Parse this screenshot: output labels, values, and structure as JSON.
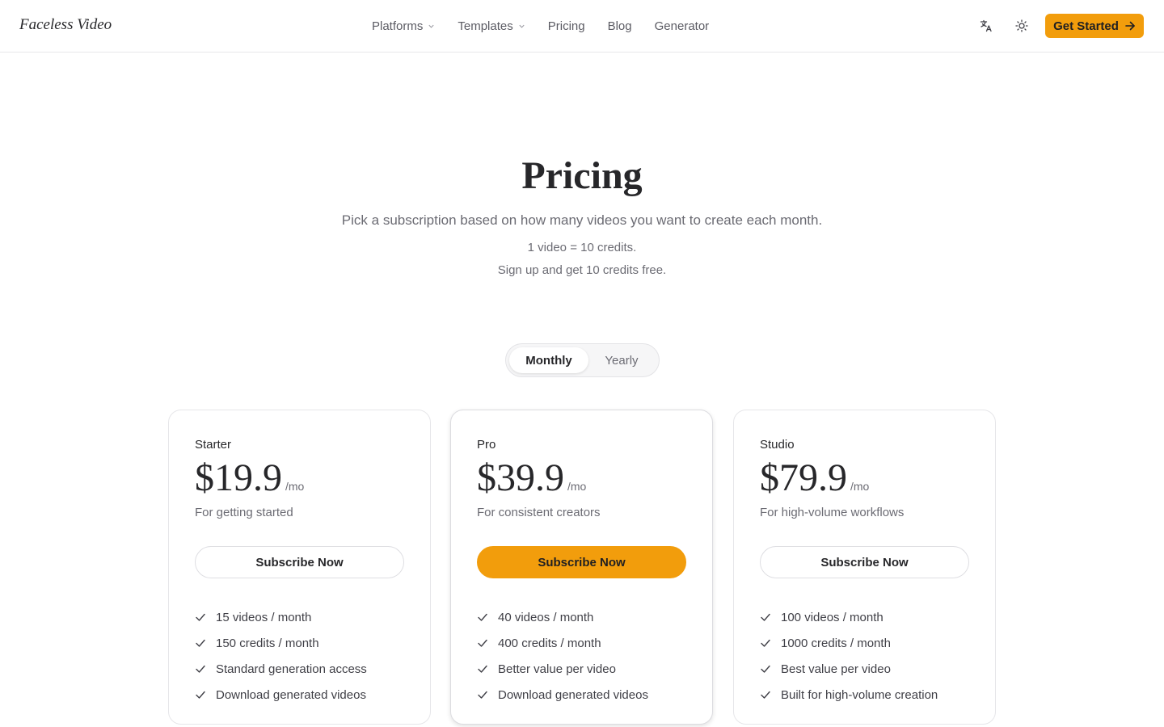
{
  "header": {
    "logo": "Faceless Video",
    "nav": [
      {
        "label": "Platforms",
        "has_dropdown": true
      },
      {
        "label": "Templates",
        "has_dropdown": true
      },
      {
        "label": "Pricing",
        "has_dropdown": false
      },
      {
        "label": "Blog",
        "has_dropdown": false
      },
      {
        "label": "Generator",
        "has_dropdown": false
      }
    ],
    "icons": [
      "translate-icon",
      "sun-icon"
    ],
    "cta_label": "Get Started",
    "cta_icon": "arrow-right-icon"
  },
  "hero": {
    "title": "Pricing",
    "subtitle": "Pick a subscription based on how many videos you want to create each month.",
    "note1": "1 video = 10 credits.",
    "note2": "Sign up and get 10 credits free."
  },
  "billing_toggle": {
    "options": [
      "Monthly",
      "Yearly"
    ],
    "selected": "Monthly"
  },
  "plans": [
    {
      "name": "Starter",
      "price": "$19.9",
      "period": "/mo",
      "description": "For getting started",
      "button": "Subscribe Now",
      "featured": false,
      "features": [
        "15 videos / month",
        "150 credits / month",
        "Standard generation access",
        "Download generated videos"
      ]
    },
    {
      "name": "Pro",
      "price": "$39.9",
      "period": "/mo",
      "description": "For consistent creators",
      "button": "Subscribe Now",
      "featured": true,
      "features": [
        "40 videos / month",
        "400 credits / month",
        "Better value per video",
        "Download generated videos"
      ]
    },
    {
      "name": "Studio",
      "price": "$79.9",
      "period": "/mo",
      "description": "For high-volume workflows",
      "button": "Subscribe Now",
      "featured": false,
      "features": [
        "100 videos / month",
        "1000 credits / month",
        "Best value per video",
        "Built for high-volume creation"
      ]
    }
  ],
  "colors": {
    "accent": "#f29d0c",
    "text": "#27272a",
    "muted": "#6b6b73",
    "border": "#e6e6e9"
  }
}
